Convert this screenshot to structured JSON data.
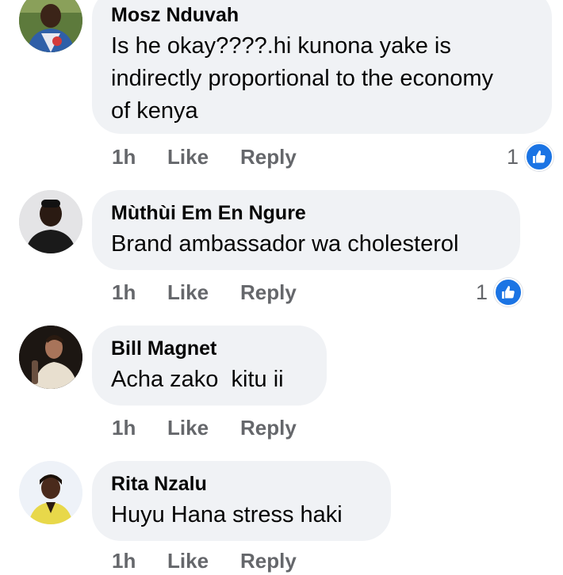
{
  "comments": [
    {
      "author": "Mosz Nduvah",
      "text": "Is he okay????.hi kunona yake is indirectly proportional to the economy of kenya",
      "time": "1h",
      "like_label": "Like",
      "reply_label": "Reply",
      "reaction_count": "1",
      "reaction_icon": "thumbs-up-icon"
    },
    {
      "author": "Mùthùi Em En Ngure",
      "text": "Brand ambassador wa cholesterol",
      "time": "1h",
      "like_label": "Like",
      "reply_label": "Reply",
      "reaction_count": "1",
      "reaction_icon": "thumbs-up-icon"
    },
    {
      "author": "Bill Magnet",
      "text": "Acha zako  kitu ii",
      "time": "1h",
      "like_label": "Like",
      "reply_label": "Reply"
    },
    {
      "author": "Rita Nzalu",
      "text": "Huyu Hana stress haki",
      "time": "1h",
      "like_label": "Like",
      "reply_label": "Reply"
    }
  ],
  "colors": {
    "bubble": "#f0f2f5",
    "secondary_text": "#65676b",
    "like_blue": "#1b74e4"
  }
}
